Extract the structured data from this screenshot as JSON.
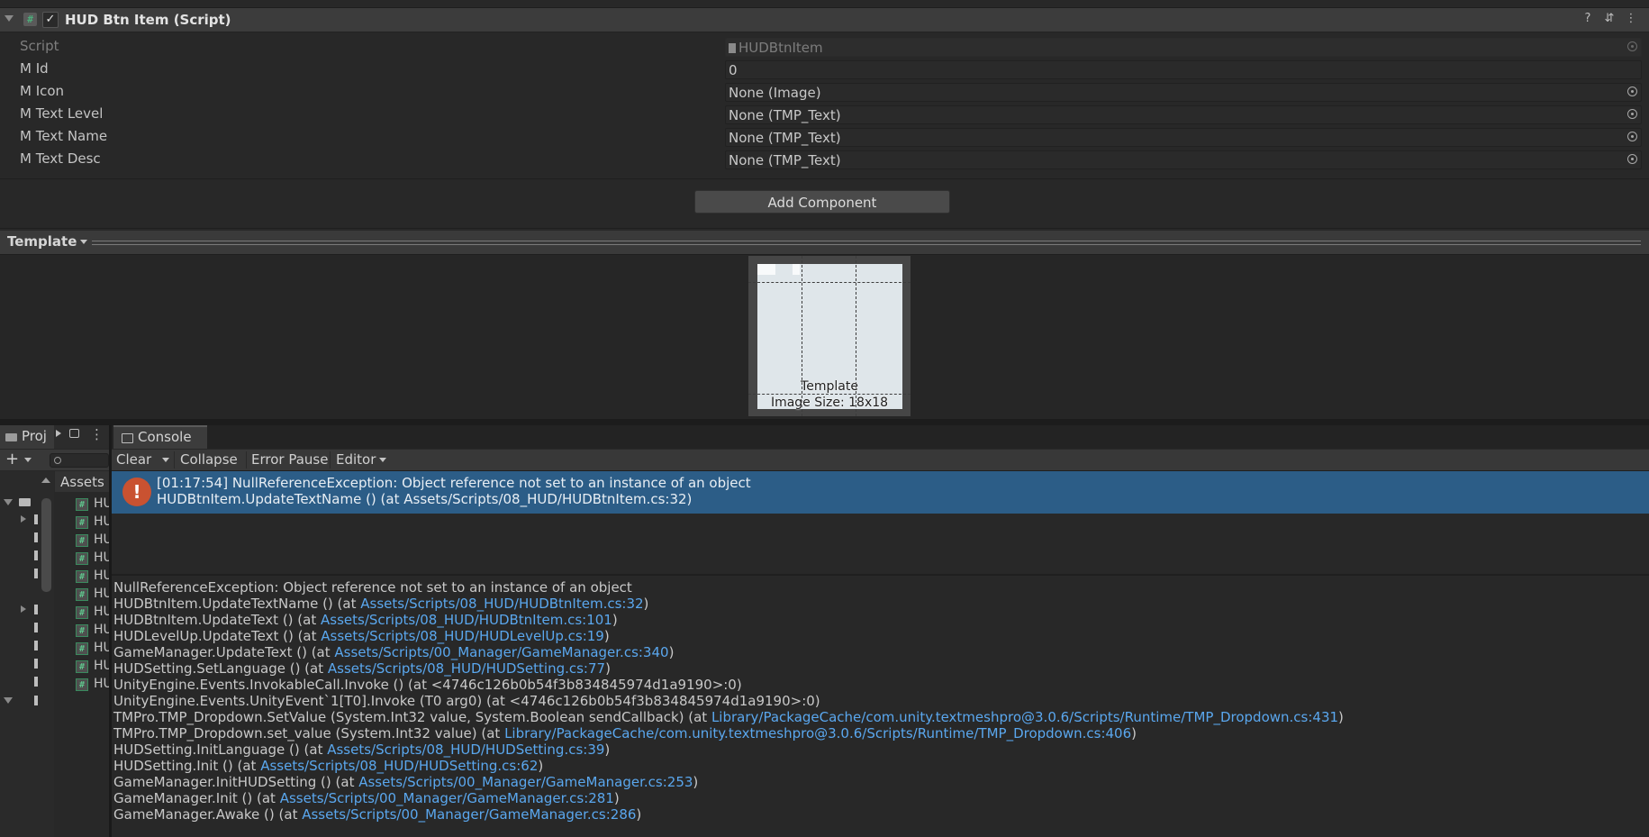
{
  "component": {
    "title": "HUD Btn Item (Script)",
    "enabled": "✓",
    "properties": [
      {
        "label": "Script",
        "value": "HUDBtnItem"
      },
      {
        "label": "M Id",
        "value": "0"
      },
      {
        "label": "M Icon",
        "value": "None (Image)"
      },
      {
        "label": "M Text Level",
        "value": "None (TMP_Text)"
      },
      {
        "label": "M Text Name",
        "value": "None (TMP_Text)"
      },
      {
        "label": "M Text Desc",
        "value": "None (TMP_Text)"
      }
    ]
  },
  "add_component_label": "Add Component",
  "preview": {
    "title": "Template",
    "thumb_name": "Template",
    "thumb_size": "Image Size: 18x18"
  },
  "project": {
    "tab_label": "Proj",
    "assets_label": "Assets",
    "items": [
      "HU",
      "HU",
      "HU",
      "HU",
      "HU",
      "HU",
      "HU",
      "HU",
      "HU",
      "HU",
      "HU"
    ]
  },
  "console": {
    "tab_label": "Console",
    "toolbar": {
      "clear": "Clear",
      "collapse": "Collapse",
      "error_pause": "Error Pause",
      "editor": "Editor"
    },
    "entry": {
      "line1": "[01:17:54] NullReferenceException: Object reference not set to an instance of an object",
      "line2": "HUDBtnItem.UpdateTextName () (at Assets/Scripts/08_HUD/HUDBtnItem.cs:32)"
    },
    "detail_header": "NullReferenceException: Object reference not set to an instance of an object",
    "stack": [
      {
        "prefix": "HUDBtnItem.UpdateTextName () (at ",
        "link": "Assets/Scripts/08_HUD/HUDBtnItem.cs:32",
        "suffix": ")"
      },
      {
        "prefix": "HUDBtnItem.UpdateText () (at ",
        "link": "Assets/Scripts/08_HUD/HUDBtnItem.cs:101",
        "suffix": ")"
      },
      {
        "prefix": "HUDLevelUp.UpdateText () (at ",
        "link": "Assets/Scripts/08_HUD/HUDLevelUp.cs:19",
        "suffix": ")"
      },
      {
        "prefix": "GameManager.UpdateText () (at ",
        "link": "Assets/Scripts/00_Manager/GameManager.cs:340",
        "suffix": ")"
      },
      {
        "prefix": "HUDSetting.SetLanguage () (at ",
        "link": "Assets/Scripts/08_HUD/HUDSetting.cs:77",
        "suffix": ")"
      },
      {
        "prefix": "UnityEngine.Events.InvokableCall.Invoke () (at <4746c126b0b54f3b834845974d1a9190>:0)",
        "link": "",
        "suffix": ""
      },
      {
        "prefix": "UnityEngine.Events.UnityEvent`1[T0].Invoke (T0 arg0) (at <4746c126b0b54f3b834845974d1a9190>:0)",
        "link": "",
        "suffix": ""
      },
      {
        "prefix": "TMPro.TMP_Dropdown.SetValue (System.Int32 value, System.Boolean sendCallback) (at ",
        "link": "Library/PackageCache/com.unity.textmeshpro@3.0.6/Scripts/Runtime/TMP_Dropdown.cs:431",
        "suffix": ")"
      },
      {
        "prefix": "TMPro.TMP_Dropdown.set_value (System.Int32 value) (at ",
        "link": "Library/PackageCache/com.unity.textmeshpro@3.0.6/Scripts/Runtime/TMP_Dropdown.cs:406",
        "suffix": ")"
      },
      {
        "prefix": "HUDSetting.InitLanguage () (at ",
        "link": "Assets/Scripts/08_HUD/HUDSetting.cs:39",
        "suffix": ")"
      },
      {
        "prefix": "HUDSetting.Init () (at ",
        "link": "Assets/Scripts/08_HUD/HUDSetting.cs:62",
        "suffix": ")"
      },
      {
        "prefix": "GameManager.InitHUDSetting () (at ",
        "link": "Assets/Scripts/00_Manager/GameManager.cs:253",
        "suffix": ")"
      },
      {
        "prefix": "GameManager.Init () (at ",
        "link": "Assets/Scripts/00_Manager/GameManager.cs:281",
        "suffix": ")"
      },
      {
        "prefix": "GameManager.Awake () (at ",
        "link": "Assets/Scripts/00_Manager/GameManager.cs:286",
        "suffix": ")"
      }
    ]
  }
}
